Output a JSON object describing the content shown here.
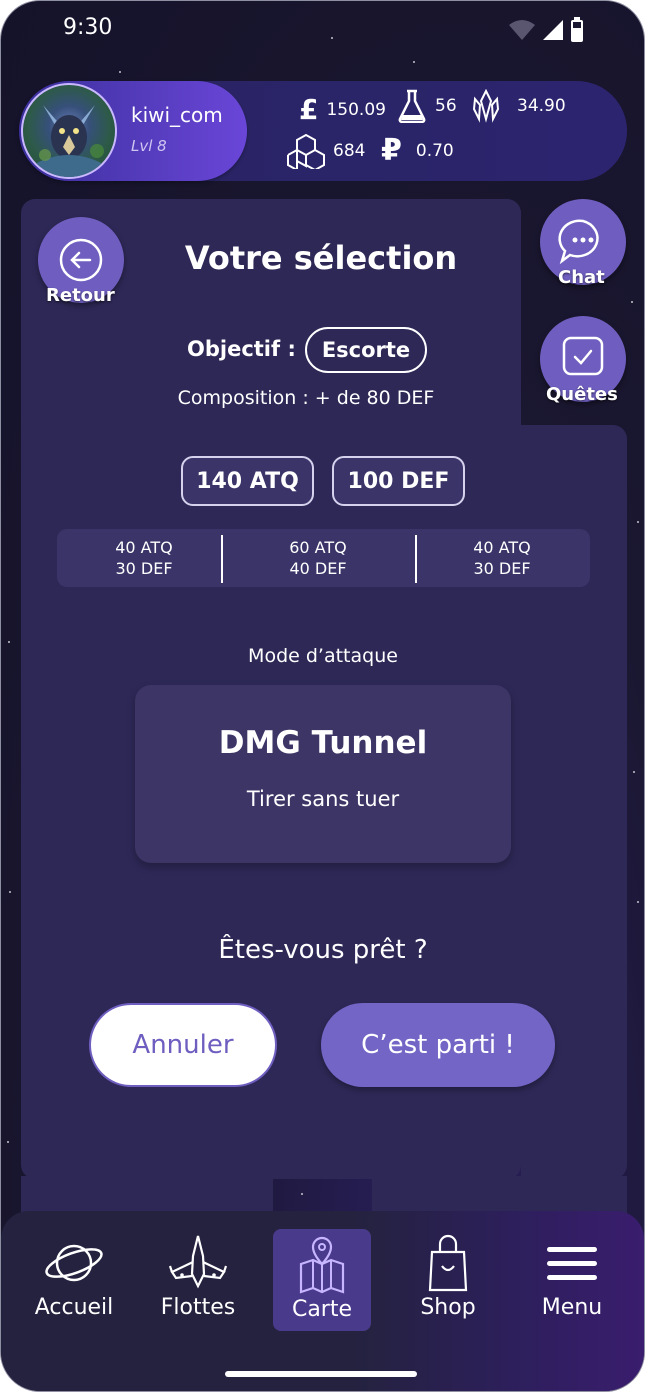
{
  "status_bar": {
    "time": "9:30"
  },
  "profile": {
    "username": "kiwi_com",
    "level": "Lvl 8"
  },
  "resources": {
    "pound": {
      "symbol": "£",
      "value": "150.09"
    },
    "flask": {
      "value": "56"
    },
    "crystal": {
      "value": "34.90"
    },
    "cubes": {
      "value": "684"
    },
    "ruble": {
      "symbol": "₽",
      "value": "0.70"
    }
  },
  "side_buttons": {
    "back_label": "Retour",
    "chat_label": "Chat",
    "quests_label": "Quêtes"
  },
  "selection": {
    "title": "Votre sélection",
    "objective_label": "Objectif :",
    "objective_value": "Escorte",
    "composition": "Composition : + de 80 DEF",
    "total_atk": "140 ATQ",
    "total_def": "100 DEF",
    "ships": [
      {
        "atk": "40 ATQ",
        "def": "30 DEF"
      },
      {
        "atk": "60 ATQ",
        "def": "40 DEF"
      },
      {
        "atk": "40 ATQ",
        "def": "30 DEF"
      }
    ],
    "attack_mode_label": "Mode d’attaque",
    "attack_mode_name": "DMG Tunnel",
    "attack_mode_desc": "Tirer sans tuer",
    "ready_question": "Êtes-vous prêt ?",
    "cancel_label": "Annuler",
    "go_label": "C’est parti !"
  },
  "nav": {
    "items": [
      {
        "label": "Accueil",
        "icon": "planet-icon"
      },
      {
        "label": "Flottes",
        "icon": "spaceship-icon"
      },
      {
        "label": "Carte",
        "icon": "map-icon",
        "active": true
      },
      {
        "label": "Shop",
        "icon": "shopping-bag-icon"
      },
      {
        "label": "Menu",
        "icon": "hamburger-menu-icon"
      }
    ]
  },
  "colors": {
    "accent": "#6f5ec0",
    "panel": "#2d2856",
    "background": "#1a1730",
    "button_go": "#7265c6"
  }
}
